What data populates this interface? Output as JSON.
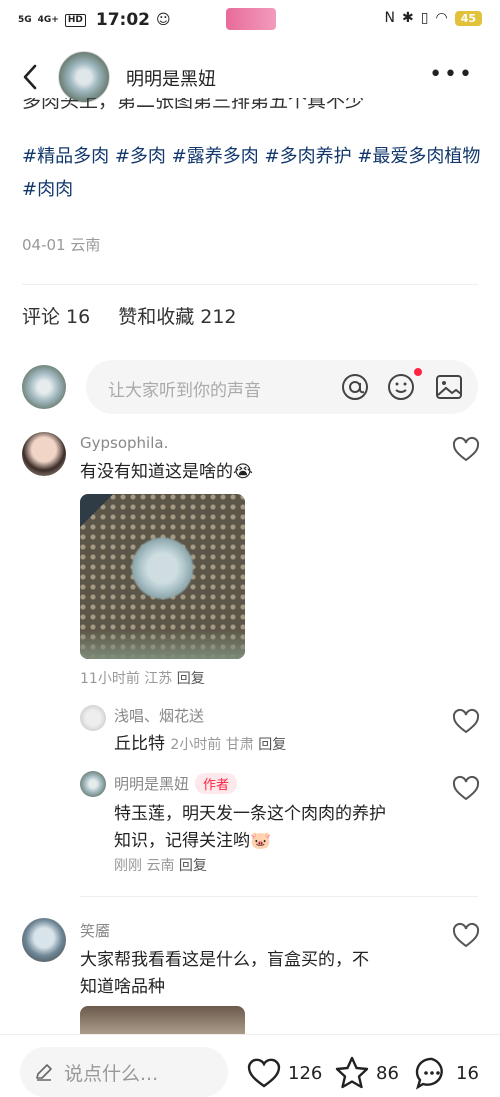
{
  "status": {
    "net1": "5G",
    "net2": "4G+",
    "hd": "HD",
    "time": "17:02",
    "battery": "45"
  },
  "header": {
    "author": "明明是黑妞"
  },
  "post": {
    "cut_text": "多肉头上，第二张图第三排第五个真不少",
    "tags": [
      "#精品多肉",
      "#多肉",
      "#露养多肉",
      "#多肉养护",
      "#最爱",
      "多肉植物",
      "#肉肉"
    ],
    "date": "04-01",
    "location": "云南"
  },
  "stats": {
    "comments": "评论 16",
    "likes_collects": "赞和收藏 212"
  },
  "comment_input": {
    "placeholder": "让大家听到你的声音"
  },
  "comments": [
    {
      "name": "Gypsophila.",
      "text": "有没有知道这是啥的😭",
      "time": "11小时前",
      "location": "江苏",
      "reply": "回复"
    },
    {
      "name": "浅唱、烟花送",
      "text": "丘比特",
      "time": "2小时前",
      "location": "甘肃",
      "reply": "回复"
    },
    {
      "name": "明明是黑妞",
      "author_tag": "作者",
      "text_line1": "特玉莲，明天发一条这个肉肉的养护",
      "text_line2": "知识，记得关注哟🐷",
      "time": "刚刚",
      "location": "云南",
      "reply": "回复"
    },
    {
      "name": "笑靥",
      "text_line1": "大家帮我看看这是什么，盲盒买的，不",
      "text_line2": "知道啥品种"
    }
  ],
  "bottom": {
    "placeholder": "说点什么...",
    "likes": "126",
    "stars": "86",
    "comments": "16"
  },
  "colors": {
    "tag": "#13386c",
    "accent": "#ff2442"
  }
}
